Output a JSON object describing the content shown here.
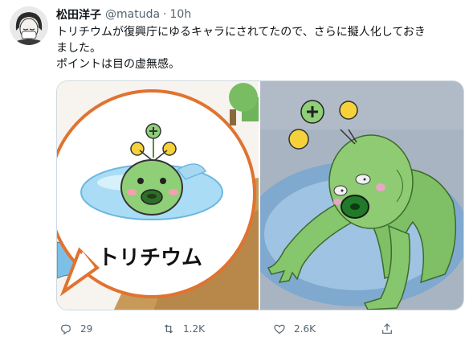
{
  "tweet": {
    "display_name": "松田洋子",
    "handle": "@matuda",
    "separator": "·",
    "time": "10h",
    "text_lines": [
      "トリチウムが復興庁にゆるキャラにされてたので、さらに擬人化しておき",
      "ました。",
      "ポイントは目の虚無感。"
    ]
  },
  "media": {
    "left_image_label": "トリチウム"
  },
  "actions": {
    "replies": "29",
    "retweets": "1.2K",
    "likes": "2.6K"
  },
  "colors": {
    "text": "#0f1419",
    "secondary": "#536471",
    "border": "#cfd9de",
    "mascot_green": "#8fcf78",
    "yellow": "#f5d23a"
  },
  "icons": [
    "reply-icon",
    "retweet-icon",
    "like-icon",
    "share-icon"
  ]
}
